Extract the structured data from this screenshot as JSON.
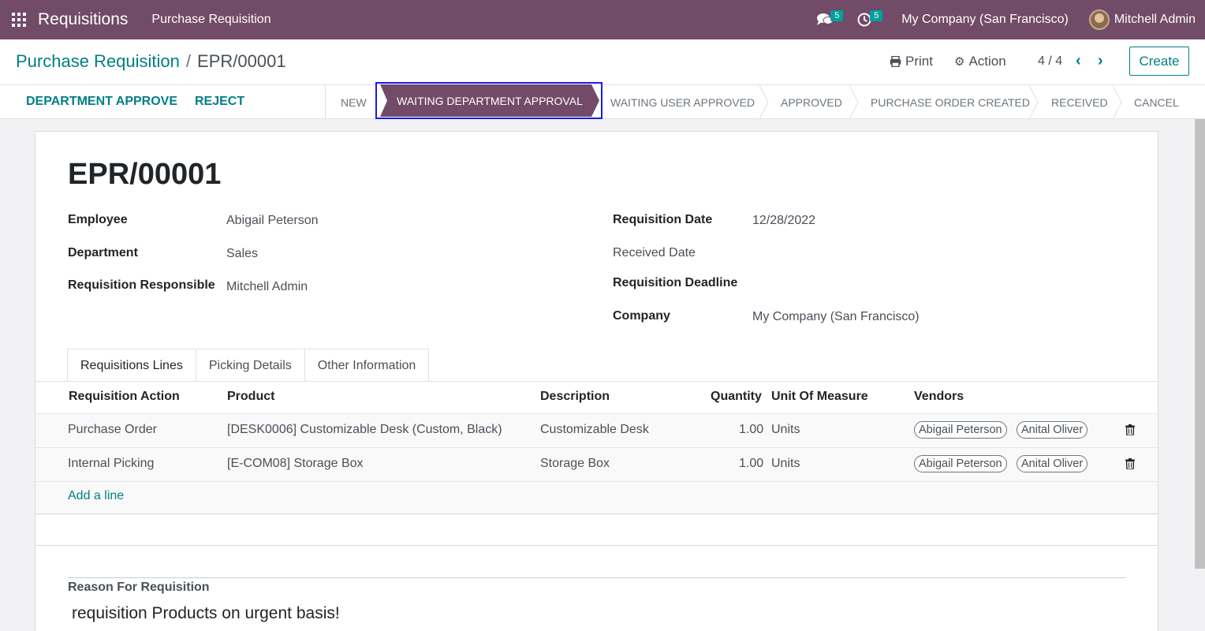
{
  "navbar": {
    "app_name": "Requisitions",
    "menu": "Purchase Requisition",
    "messages_badge": "5",
    "activities_badge": "5",
    "company": "My Company (San Francisco)",
    "user": "Mitchell Admin"
  },
  "control": {
    "breadcrumb_parent": "Purchase Requisition",
    "breadcrumb_sep": "/",
    "breadcrumb_current": "EPR/00001",
    "print_label": "Print",
    "action_label": "Action",
    "pager": "4 / 4",
    "create_label": "Create"
  },
  "statusbar": {
    "actions": [
      "DEPARTMENT APPROVE",
      "REJECT"
    ],
    "stages": [
      "NEW",
      "WAITING DEPARTMENT APPROVAL",
      "WAITING USER APPROVED",
      "APPROVED",
      "PURCHASE ORDER CREATED",
      "RECEIVED",
      "CANCEL"
    ],
    "active_stage": "WAITING DEPARTMENT APPROVAL"
  },
  "form": {
    "title": "EPR/00001",
    "employee_label": "Employee",
    "employee": "Abigail Peterson",
    "department_label": "Department",
    "department": "Sales",
    "responsible_label": "Requisition Responsible",
    "responsible": "Mitchell Admin",
    "req_date_label": "Requisition Date",
    "req_date": "12/28/2022",
    "received_date_label": "Received Date",
    "deadline_label": "Requisition Deadline",
    "company_label": "Company",
    "company": "My Company (San Francisco)"
  },
  "tabs": [
    "Requisitions Lines",
    "Picking Details",
    "Other Information"
  ],
  "table": {
    "headers": [
      "Requisition Action",
      "Product",
      "Description",
      "Quantity",
      "Unit Of Measure",
      "Vendors"
    ],
    "rows": [
      {
        "action": "Purchase Order",
        "product": "[DESK0006] Customizable Desk (Custom, Black)",
        "description": "Customizable Desk",
        "quantity": "1.00",
        "uom": "Units",
        "vendors": [
          "Abigail Peterson",
          "Anital Oliver"
        ]
      },
      {
        "action": "Internal Picking",
        "product": "[E-COM08] Storage Box",
        "description": "Storage Box",
        "quantity": "1.00",
        "uom": "Units",
        "vendors": [
          "Abigail Peterson",
          "Anital Oliver"
        ]
      }
    ],
    "add_line": "Add a line"
  },
  "reason": {
    "label": "Reason For Requisition",
    "value": "requisition Products on urgent basis!"
  },
  "colors": {
    "brand": "#714b67",
    "accent": "#017e84",
    "badge": "#00a09d"
  }
}
